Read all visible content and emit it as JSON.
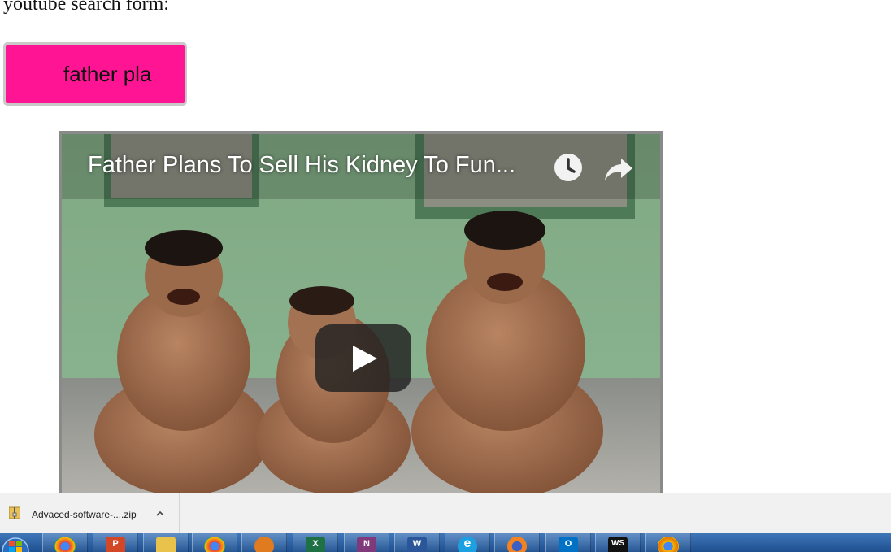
{
  "page": {
    "heading": "youtube search form:"
  },
  "search": {
    "value": "father pla",
    "bg": "#ff1493"
  },
  "video": {
    "title": "Father Plans To Sell His Kidney To Fun..."
  },
  "download_bar": {
    "file_name": "Advaced-software-....zip"
  },
  "taskbar": {
    "items": [
      {
        "icon": "chrome-icon"
      },
      {
        "icon": "powerpoint-icon",
        "label": "P"
      },
      {
        "icon": "file-explorer-icon"
      },
      {
        "icon": "chrome-icon"
      },
      {
        "icon": "media-player-icon"
      },
      {
        "icon": "excel-icon",
        "label": "X"
      },
      {
        "icon": "onenote-icon",
        "label": "N"
      },
      {
        "icon": "word-icon",
        "label": "W"
      },
      {
        "icon": "internet-explorer-icon",
        "label": "e"
      },
      {
        "icon": "firefox-icon"
      },
      {
        "icon": "outlook-icon",
        "label": "O"
      },
      {
        "icon": "webstorm-icon",
        "label": "WS"
      },
      {
        "icon": "chrome-canary-icon"
      }
    ]
  }
}
